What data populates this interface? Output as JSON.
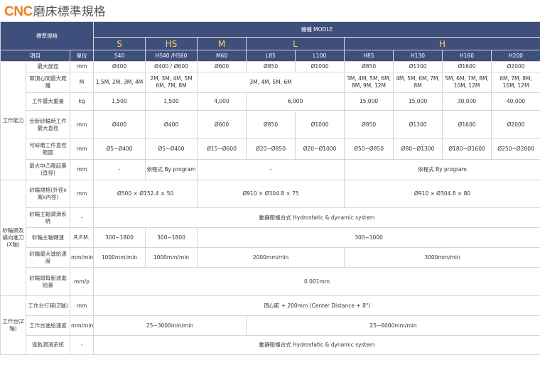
{
  "page": {
    "title_brand": "CNC",
    "title_rest": "磨床標準規格"
  },
  "header": {
    "spec": "標準規格",
    "model_group": "機種 MODLE",
    "item": "項目",
    "unit": "單位",
    "series": [
      "S",
      "HS",
      "M",
      "L",
      "H"
    ],
    "models": [
      "S40",
      "HS40 /HS60",
      "M60",
      "L85",
      "L100",
      "H85",
      "H130",
      "H160",
      "H200"
    ]
  },
  "groups": {
    "work": "工作能力",
    "wheel": "砂輪頭及橫向進刀(X軸)",
    "table": "工作台(Z軸)"
  },
  "rows": {
    "r1": {
      "label": "最大旋徑",
      "unit": "mm",
      "v": [
        "Ø400",
        "Ø400 / Ø600",
        "Ø600",
        "Ø850",
        "Ø1000",
        "Ø850",
        "Ø1300",
        "Ø1600",
        "Ø2000"
      ]
    },
    "r2": {
      "label": "兩頂心間最大距離",
      "unit": "M",
      "v": [
        "1.5M, 2M, 3M, 4M",
        "2M, 3M, 4M, 5M 6M, 7M, 8M",
        "3M, 4M, 5M, 6M",
        "3M, 4M, 5M, 6M, 8M, 9M, 12M",
        "4M, 5M, 6M, 7M, 8M",
        "5M, 6M, 7M, 8M, 10M, 12M",
        "6M, 7M, 8M, 10M, 12M"
      ]
    },
    "r3": {
      "label": "工件最大重量",
      "unit": "kg",
      "v": [
        "1,500",
        "1,500",
        "4,000",
        "6,000",
        "15,000",
        "15,000",
        "30,000",
        "40,000"
      ]
    },
    "r4": {
      "label": "全新砂輪時工件最大直徑",
      "unit": "mm",
      "v": [
        "Ø400",
        "Ø400",
        "Ø600",
        "Ø850",
        "Ø1000",
        "Ø850",
        "Ø1300",
        "Ø1600",
        "Ø2000"
      ]
    },
    "r5": {
      "label": "可研磨工件直徑範圍",
      "unit": "mm",
      "v": [
        "Ø5~Ø400",
        "Ø5~Ø400",
        "Ø15~Ø600",
        "Ø20~Ø850",
        "Ø20~Ø1000",
        "Ø50~Ø850",
        "Ø80~Ø1300",
        "Ø180~Ø1600",
        "Ø250~Ø2000"
      ]
    },
    "r6": {
      "label": "最大中凸隆起量(直徑)",
      "unit": "mm",
      "v": [
        "-",
        "依程式 By program",
        "-",
        "依程式 By program"
      ]
    },
    "r7": {
      "label": "砂輪規格(外徑x寬x內徑)",
      "unit": "mm",
      "v": [
        "Ø500 × Ø152.4 × 50",
        "Ø910 × Ø304.8 × 75",
        "Ø910 × Ø304.8 × 80"
      ]
    },
    "r8": {
      "label": "砂輪主軸潤滑系統",
      "unit": "-",
      "v": [
        "動靜壓複合式 Hydrostatic & dynamic system"
      ]
    },
    "r9": {
      "label": "砂輪主軸轉速",
      "unit": "R.P.M.",
      "v": [
        "300~1800",
        "300~1800",
        "300~1000"
      ]
    },
    "r10": {
      "label": "砂輪最大進給速度",
      "unit": "mm/min",
      "v": [
        "1000mm/min",
        "1000mm/min",
        "2000mm/min",
        "3000mm/min"
      ]
    },
    "r11": {
      "label": "砂輪頭每脈波進給量",
      "unit": "mm/p",
      "v": [
        "0.001mm"
      ]
    },
    "r12": {
      "label": "工作台行程(Z軸)",
      "unit": "mm",
      "v": [
        "頂心距 + 200mm (Center Distance + 8\")"
      ]
    },
    "r13": {
      "label": "工作台進給速度",
      "unit": "mm/min",
      "v": [
        "25~3000mm/min",
        "25~6000mm/min"
      ]
    },
    "r14": {
      "label": "導軌潤滑系統",
      "unit": "-",
      "v": [
        "動靜壓複合式 Hydrostatic & dynamic system"
      ]
    }
  }
}
